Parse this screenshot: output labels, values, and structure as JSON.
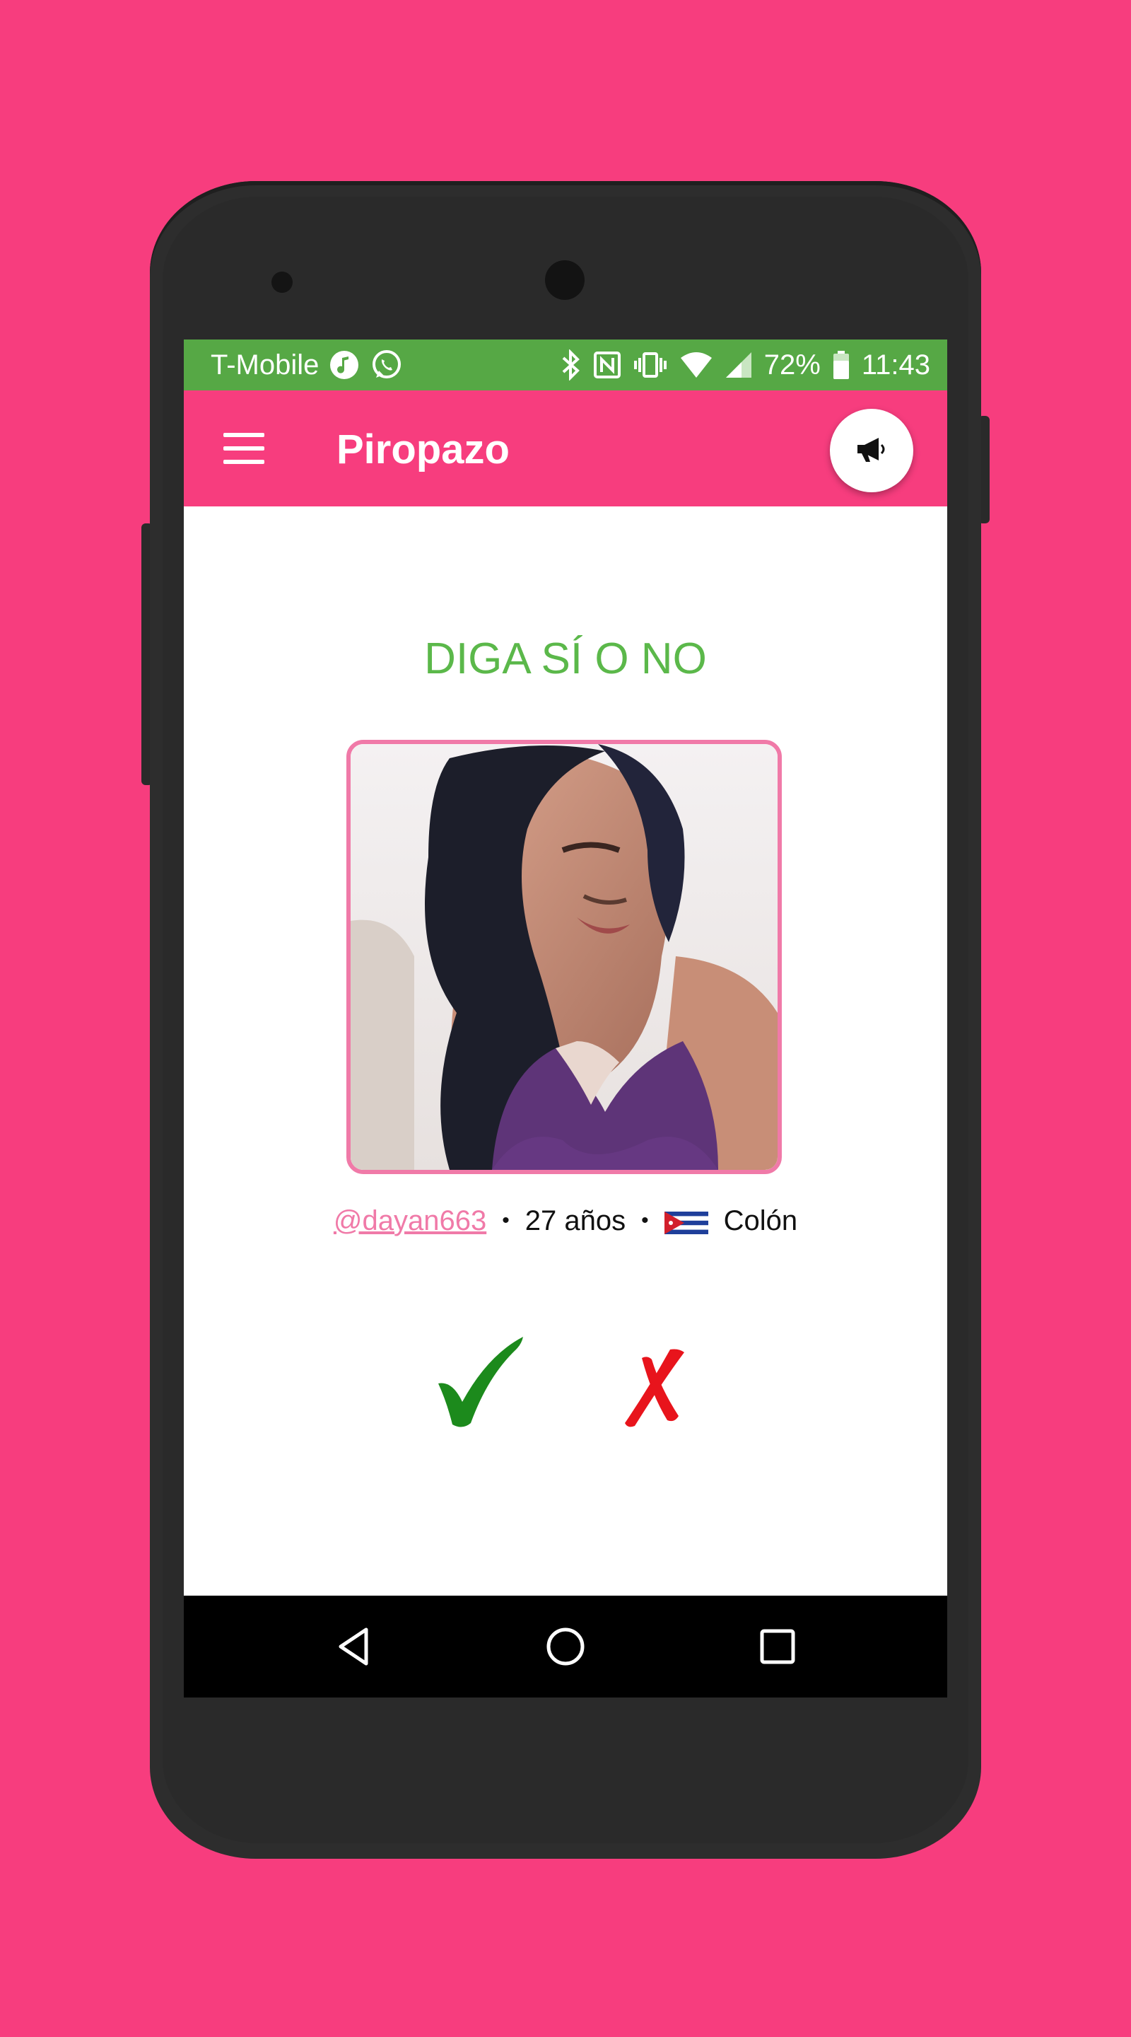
{
  "status_bar": {
    "carrier": "T-Mobile",
    "battery": "72%",
    "time": "11:43",
    "icons_left": [
      "music-note-icon",
      "whatsapp-icon"
    ],
    "icons_right": [
      "bluetooth-icon",
      "nfc-icon",
      "vibrate-icon",
      "wifi-icon",
      "signal-icon",
      "battery-icon"
    ]
  },
  "app_bar": {
    "title": "Piropazo",
    "menu_icon": "hamburger-menu-icon",
    "action_icon": "megaphone-icon"
  },
  "main": {
    "headline": "DIGA SÍ O NO",
    "profile": {
      "username": "@dayan663",
      "age": "27 años",
      "separator": "•",
      "location": "Colón",
      "flag": "cuba-flag-icon"
    },
    "actions": {
      "yes_icon": "check-mark-icon",
      "no_icon": "x-mark-icon"
    }
  },
  "nav_bar": {
    "back": "back-triangle-icon",
    "home": "home-circle-icon",
    "recents": "recents-square-icon"
  },
  "colors": {
    "background": "#f73d7e",
    "status_bar": "#56a845",
    "app_bar": "#f73d7e",
    "headline": "#5bb84a",
    "accent_pink": "#f07aa8",
    "yes_green": "#1c8a1c",
    "no_red": "#e8141c"
  }
}
